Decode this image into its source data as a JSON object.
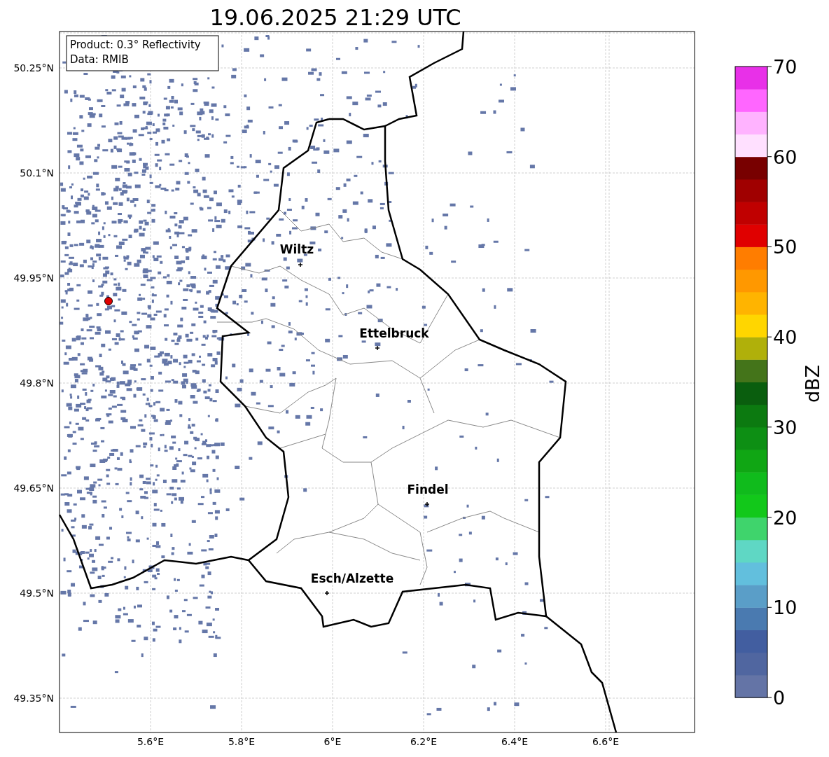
{
  "title": "19.06.2025 21:29 UTC",
  "info_box": [
    "Product: 0.3° Reflectivity",
    "Data: RMIB"
  ],
  "lat_ticks": [
    "50.25°N",
    "50.1°N",
    "49.95°N",
    "49.8°N",
    "49.65°N",
    "49.5°N",
    "49.35°N"
  ],
  "lon_ticks": [
    "5.6°E",
    "5.8°E",
    "6°E",
    "6.2°E",
    "6.4°E",
    "6.6°E"
  ],
  "cities": [
    {
      "name": "Wiltz"
    },
    {
      "name": "Ettelbruck"
    },
    {
      "name": "Findel"
    },
    {
      "name": "Esch/Alzette"
    }
  ],
  "colorbar": {
    "label": "dBZ",
    "ticks": [
      "70",
      "60",
      "50",
      "40",
      "30",
      "20",
      "10",
      "0"
    ],
    "segments": [
      {
        "color": "#6474a6"
      },
      {
        "color": "#5066a0"
      },
      {
        "color": "#425ea0"
      },
      {
        "color": "#4a7ab0"
      },
      {
        "color": "#5a9ec8"
      },
      {
        "color": "#62bfdd"
      },
      {
        "color": "#5fd7c4"
      },
      {
        "color": "#3fd46c"
      },
      {
        "color": "#12c81a"
      },
      {
        "color": "#10bb1c"
      },
      {
        "color": "#10a614"
      },
      {
        "color": "#0d8f14"
      },
      {
        "color": "#0c7a10"
      },
      {
        "color": "#0a5e0e"
      },
      {
        "color": "#44741a"
      },
      {
        "color": "#b0b00a"
      },
      {
        "color": "#ffd600"
      },
      {
        "color": "#ffb400"
      },
      {
        "color": "#ff9800"
      },
      {
        "color": "#ff7d00"
      },
      {
        "color": "#e00000"
      },
      {
        "color": "#c00000"
      },
      {
        "color": "#a00000"
      },
      {
        "color": "#780000"
      },
      {
        "color": "#ffe0ff"
      },
      {
        "color": "#ffb3ff"
      },
      {
        "color": "#ff66ff"
      },
      {
        "color": "#e830e8"
      }
    ]
  }
}
